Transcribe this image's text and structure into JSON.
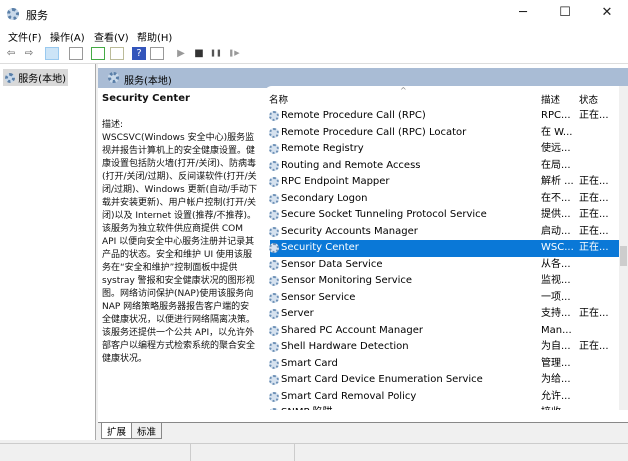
{
  "window": {
    "title": "服务",
    "minimize": "─",
    "maximize": "☐",
    "close": "✕"
  },
  "menu": [
    "文件(F)",
    "操作(A)",
    "查看(V)",
    "帮助(H)"
  ],
  "toolbar": {
    "back": "⇦",
    "forward": "⇨",
    "help": "?",
    "start": "▶",
    "stop": "■",
    "pause": "❚❚",
    "restart": "❚▶"
  },
  "tree": {
    "root": "服务(本地)"
  },
  "header": {
    "title": "服务(本地)"
  },
  "description": {
    "service_name": "Security Center",
    "label": "描述:",
    "text": "WSCSVC(Windows 安全中心)服务监视并报告计算机上的安全健康设置。健康设置包括防火墙(打开/关闭)、防病毒(打开/关闭/过期)、反间谍软件(打开/关闭/过期)、Windows 更新(自动/手动下载并安装更新)、用户帐户控制(打开/关闭)以及 Internet 设置(推荐/不推荐)。该服务为独立软件供应商提供 COM API 以便向安全中心服务注册并记录其产品的状态。安全和维护 UI 使用该服务在“安全和维护”控制面板中提供 systray 警报和安全健康状况的图形视图。网络访问保护(NAP)使用该服务向 NAP 网络策略服务器报告客户端的安全健康状况，以便进行网络隔离决策。该服务还提供一个公共 API，以允许外部客户以编程方式检索系统的聚合安全健康状况。"
  },
  "columns": {
    "name": "名称",
    "desc": "描述",
    "status": "状态",
    "sort": "^"
  },
  "services": [
    {
      "name": "Remote Procedure Call (RPC)",
      "desc": "RPC...",
      "status": "正在..."
    },
    {
      "name": "Remote Procedure Call (RPC) Locator",
      "desc": "在 W...",
      "status": ""
    },
    {
      "name": "Remote Registry",
      "desc": "使远...",
      "status": ""
    },
    {
      "name": "Routing and Remote Access",
      "desc": "在局...",
      "status": ""
    },
    {
      "name": "RPC Endpoint Mapper",
      "desc": "解析 ...",
      "status": "正在..."
    },
    {
      "name": "Secondary Logon",
      "desc": "在不...",
      "status": "正在..."
    },
    {
      "name": "Secure Socket Tunneling Protocol Service",
      "desc": "提供...",
      "status": "正在..."
    },
    {
      "name": "Security Accounts Manager",
      "desc": "启动...",
      "status": "正在..."
    },
    {
      "name": "Security Center",
      "desc": "WSC...",
      "status": "正在...",
      "selected": true
    },
    {
      "name": "Sensor Data Service",
      "desc": "从各...",
      "status": ""
    },
    {
      "name": "Sensor Monitoring Service",
      "desc": "监视...",
      "status": ""
    },
    {
      "name": "Sensor Service",
      "desc": "一项...",
      "status": ""
    },
    {
      "name": "Server",
      "desc": "支持...",
      "status": "正在..."
    },
    {
      "name": "Shared PC Account Manager",
      "desc": "Man...",
      "status": ""
    },
    {
      "name": "Shell Hardware Detection",
      "desc": "为自...",
      "status": "正在..."
    },
    {
      "name": "Smart Card",
      "desc": "管理...",
      "status": ""
    },
    {
      "name": "Smart Card Device Enumeration Service",
      "desc": "为给...",
      "status": ""
    },
    {
      "name": "Smart Card Removal Policy",
      "desc": "允许...",
      "status": ""
    },
    {
      "name": "SNMP 陷阱",
      "desc": "接收...",
      "status": ""
    }
  ],
  "tabs": [
    "扩展",
    "标准"
  ],
  "colors": {
    "selection": "#0a78d7",
    "band": "#a9bcd5"
  }
}
